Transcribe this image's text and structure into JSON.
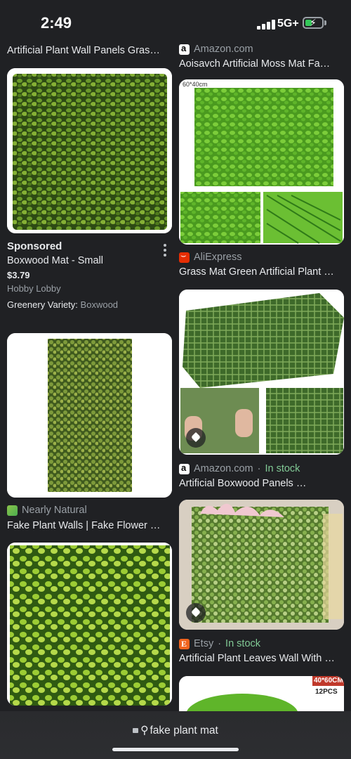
{
  "status": {
    "time": "2:49",
    "network": "5G+"
  },
  "left": {
    "top_title": "Artificial Plant Wall Panels Gras…",
    "sponsored": {
      "label": "Sponsored",
      "title": "Boxwood Mat - Small",
      "price": "$3.79",
      "store": "Hobby Lobby",
      "attr_label": "Greenery Variety:",
      "attr_value": "Boxwood"
    },
    "card2": {
      "source": "Nearly Natural",
      "title": "Fake Plant Walls | Fake Flower …"
    }
  },
  "right": {
    "card1": {
      "source": "Amazon.com",
      "title": "Aoisavch Artificial Moss Mat Fa…",
      "img_text": "60*40cm"
    },
    "card2": {
      "source": "AliExpress",
      "title": "Grass Mat Green Artificial Plant …"
    },
    "card3": {
      "source": "Amazon.com",
      "stock": "In stock",
      "title": "Artificial Boxwood Panels …"
    },
    "card4": {
      "source": "Etsy",
      "stock": "In stock",
      "title": "Artificial Plant Leaves Wall With …"
    },
    "card5": {
      "img_text_1": "40*60CM",
      "img_text_2": "12PCS"
    }
  },
  "address_bar": {
    "query": "fake plant mat"
  },
  "colors": {
    "background": "#202124",
    "stock_green": "#81c995",
    "muted": "#9aa0a6"
  }
}
